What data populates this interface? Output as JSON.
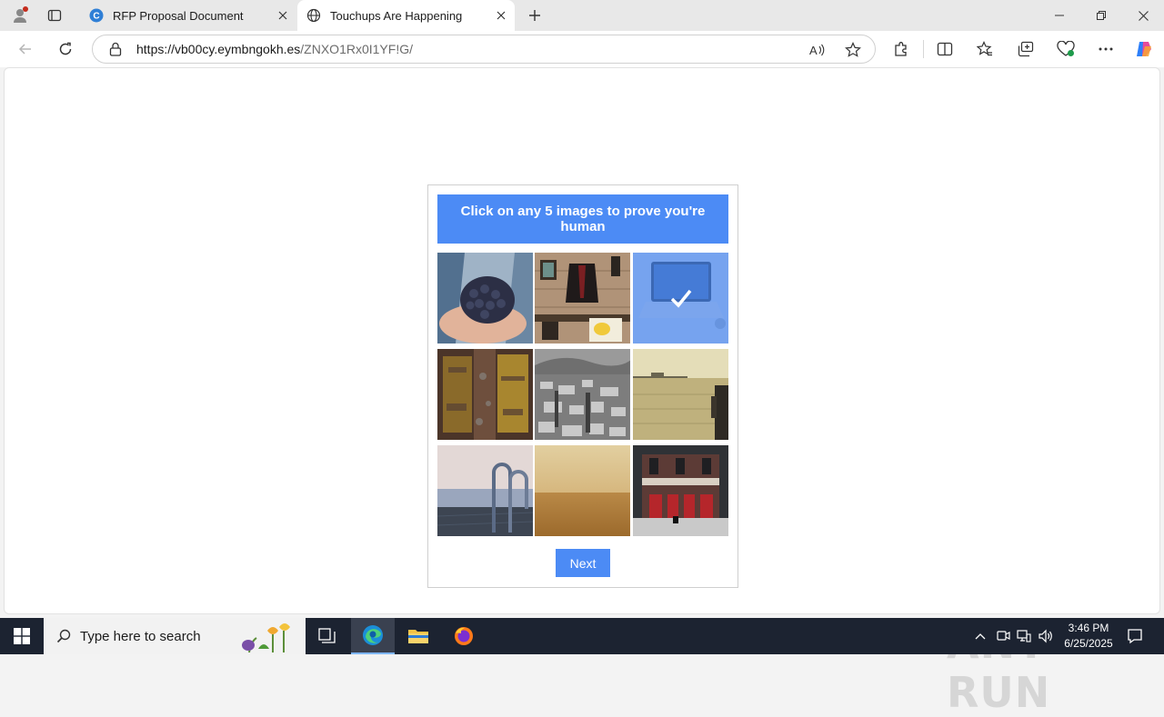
{
  "browser": {
    "tabs": [
      {
        "title": "RFP Proposal Document",
        "active": false
      },
      {
        "title": "Touchups Are Happening",
        "active": true
      }
    ],
    "url_host": "https://vb00cy.eymbngokh.es",
    "url_path": "/ZNXO1Rx0I1YF!G/"
  },
  "captcha": {
    "heading": "Click on any 5 images to prove you're human",
    "tiles": [
      {
        "subject": "grapes-in-hands",
        "selected": false
      },
      {
        "subject": "coat-on-shelf",
        "selected": false
      },
      {
        "subject": "laptop",
        "selected": true
      },
      {
        "subject": "weathered-door",
        "selected": false
      },
      {
        "subject": "city-aerial",
        "selected": false
      },
      {
        "subject": "waterfront",
        "selected": false
      },
      {
        "subject": "pool-ladder",
        "selected": false
      },
      {
        "subject": "desert",
        "selected": false
      },
      {
        "subject": "theater-facade",
        "selected": false
      }
    ],
    "next_label": "Next"
  },
  "watermark": "ANY RUN",
  "taskbar": {
    "search_placeholder": "Type here to search",
    "time": "3:46 PM",
    "date": "6/25/2025"
  },
  "colors": {
    "accent": "#4c8bf5",
    "taskbar": "#1c2331"
  }
}
